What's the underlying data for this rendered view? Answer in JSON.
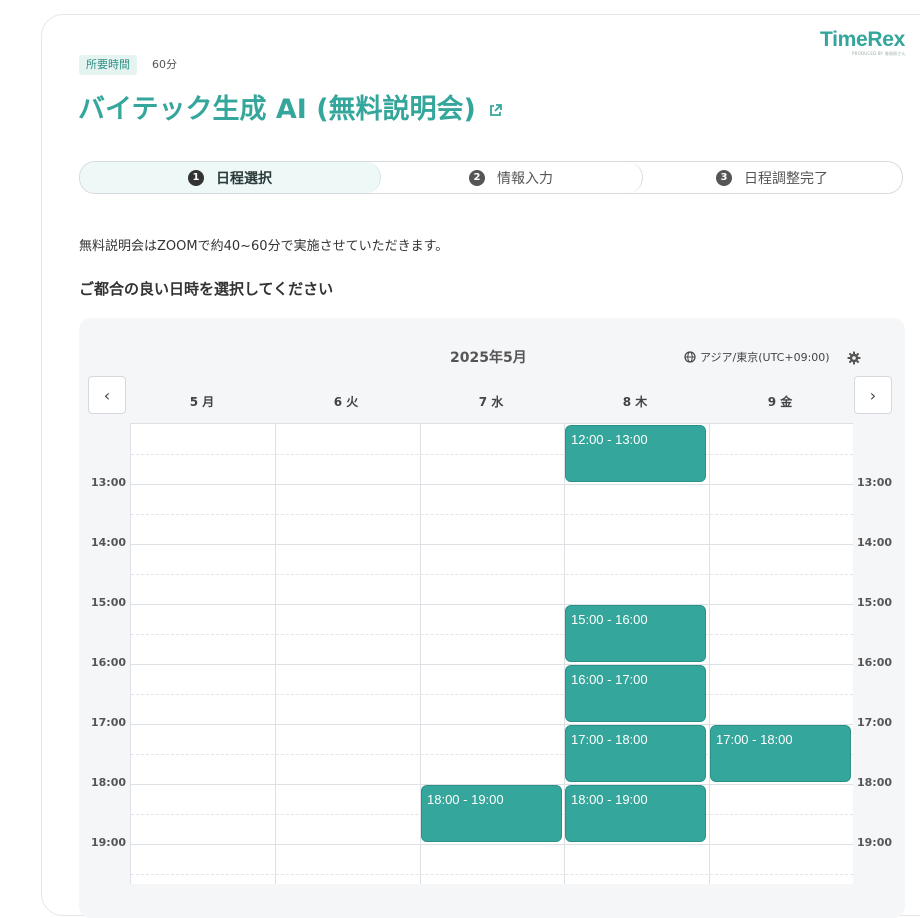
{
  "brand": {
    "logo": "TimeRex",
    "logo_sub": "PRODUCED BY 冊冊冊さん",
    "accent": "#35a69b"
  },
  "event": {
    "duration_label": "所要時間",
    "duration_value": "60分",
    "title": "バイテック生成 AI (無料説明会)",
    "description": "無料説明会はZOOMで約40~60分で実施させていただきます。",
    "prompt": "ご都合の良い日時を選択してください"
  },
  "steps": [
    {
      "num": "1",
      "label": "日程選択",
      "active": true
    },
    {
      "num": "2",
      "label": "情報入力",
      "active": false
    },
    {
      "num": "3",
      "label": "日程調整完了",
      "active": false
    }
  ],
  "calendar": {
    "month": "2025年5月",
    "timezone": "アジア/東京(UTC+09:00)",
    "prev_icon": "‹",
    "next_icon": "›",
    "days": [
      "5 月",
      "6 火",
      "7 水",
      "8 木",
      "9 金"
    ],
    "hours": [
      "13:00",
      "14:00",
      "15:00",
      "16:00",
      "17:00",
      "18:00",
      "19:00"
    ],
    "slots": [
      {
        "day": 3,
        "start": 12,
        "label": "12:00 - 13:00"
      },
      {
        "day": 3,
        "start": 15,
        "label": "15:00 - 16:00"
      },
      {
        "day": 3,
        "start": 16,
        "label": "16:00 - 17:00"
      },
      {
        "day": 3,
        "start": 17,
        "label": "17:00 - 18:00"
      },
      {
        "day": 4,
        "start": 17,
        "label": "17:00 - 18:00"
      },
      {
        "day": 2,
        "start": 18,
        "label": "18:00 - 19:00"
      },
      {
        "day": 3,
        "start": 18,
        "label": "18:00 - 19:00"
      }
    ]
  }
}
